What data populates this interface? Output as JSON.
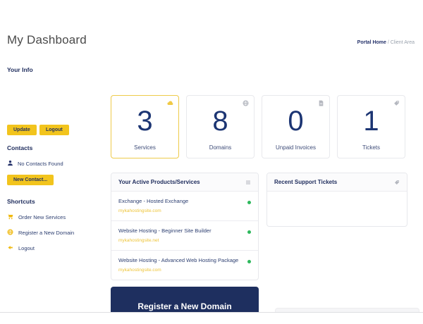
{
  "page": {
    "title": "My Dashboard",
    "breadcrumb": {
      "home": "Portal Home",
      "separator": "/",
      "current": "Client Area"
    }
  },
  "sidebar": {
    "your_info_heading": "Your Info",
    "update_button": "Update",
    "logout_button": "Logout",
    "contacts_heading": "Contacts",
    "no_contacts_text": "No Contacts Found",
    "new_contact_button": "New Contact...",
    "shortcuts_heading": "Shortcuts",
    "shortcuts": [
      {
        "label": "Order New Services",
        "icon": "cart-icon"
      },
      {
        "label": "Register a New Domain",
        "icon": "globe-icon"
      },
      {
        "label": "Logout",
        "icon": "sign-out-icon"
      }
    ]
  },
  "stats": [
    {
      "value": "3",
      "label": "Services",
      "icon": "cloud-icon",
      "highlighted": true
    },
    {
      "value": "8",
      "label": "Domains",
      "icon": "globe-icon",
      "highlighted": false
    },
    {
      "value": "0",
      "label": "Unpaid Invoices",
      "icon": "invoice-icon",
      "highlighted": false
    },
    {
      "value": "1",
      "label": "Tickets",
      "icon": "tag-icon",
      "highlighted": false
    }
  ],
  "products_panel": {
    "title": "Your Active Products/Services",
    "icon": "list-icon",
    "items": [
      {
        "name": "Exchange - Hosted Exchange",
        "domain": "mykahostingsite.com",
        "status": "active"
      },
      {
        "name": "Website Hosting - Beginner Site Builder",
        "domain": "mykahostingsite.net",
        "status": "active"
      },
      {
        "name": "Website Hosting - Advanced Web Hosting Package",
        "domain": "mykahostingsite.com",
        "status": "active"
      }
    ]
  },
  "tickets_panel": {
    "title": "Recent Support Tickets",
    "icon": "tag-icon"
  },
  "register_banner": {
    "label": "Register a New Domain"
  },
  "colors": {
    "navy": "#223a70",
    "dark_navy": "#1e2f5f",
    "yellow": "#f2c41d",
    "green": "#2eb85c",
    "gray_icon": "#b4b7bf"
  }
}
